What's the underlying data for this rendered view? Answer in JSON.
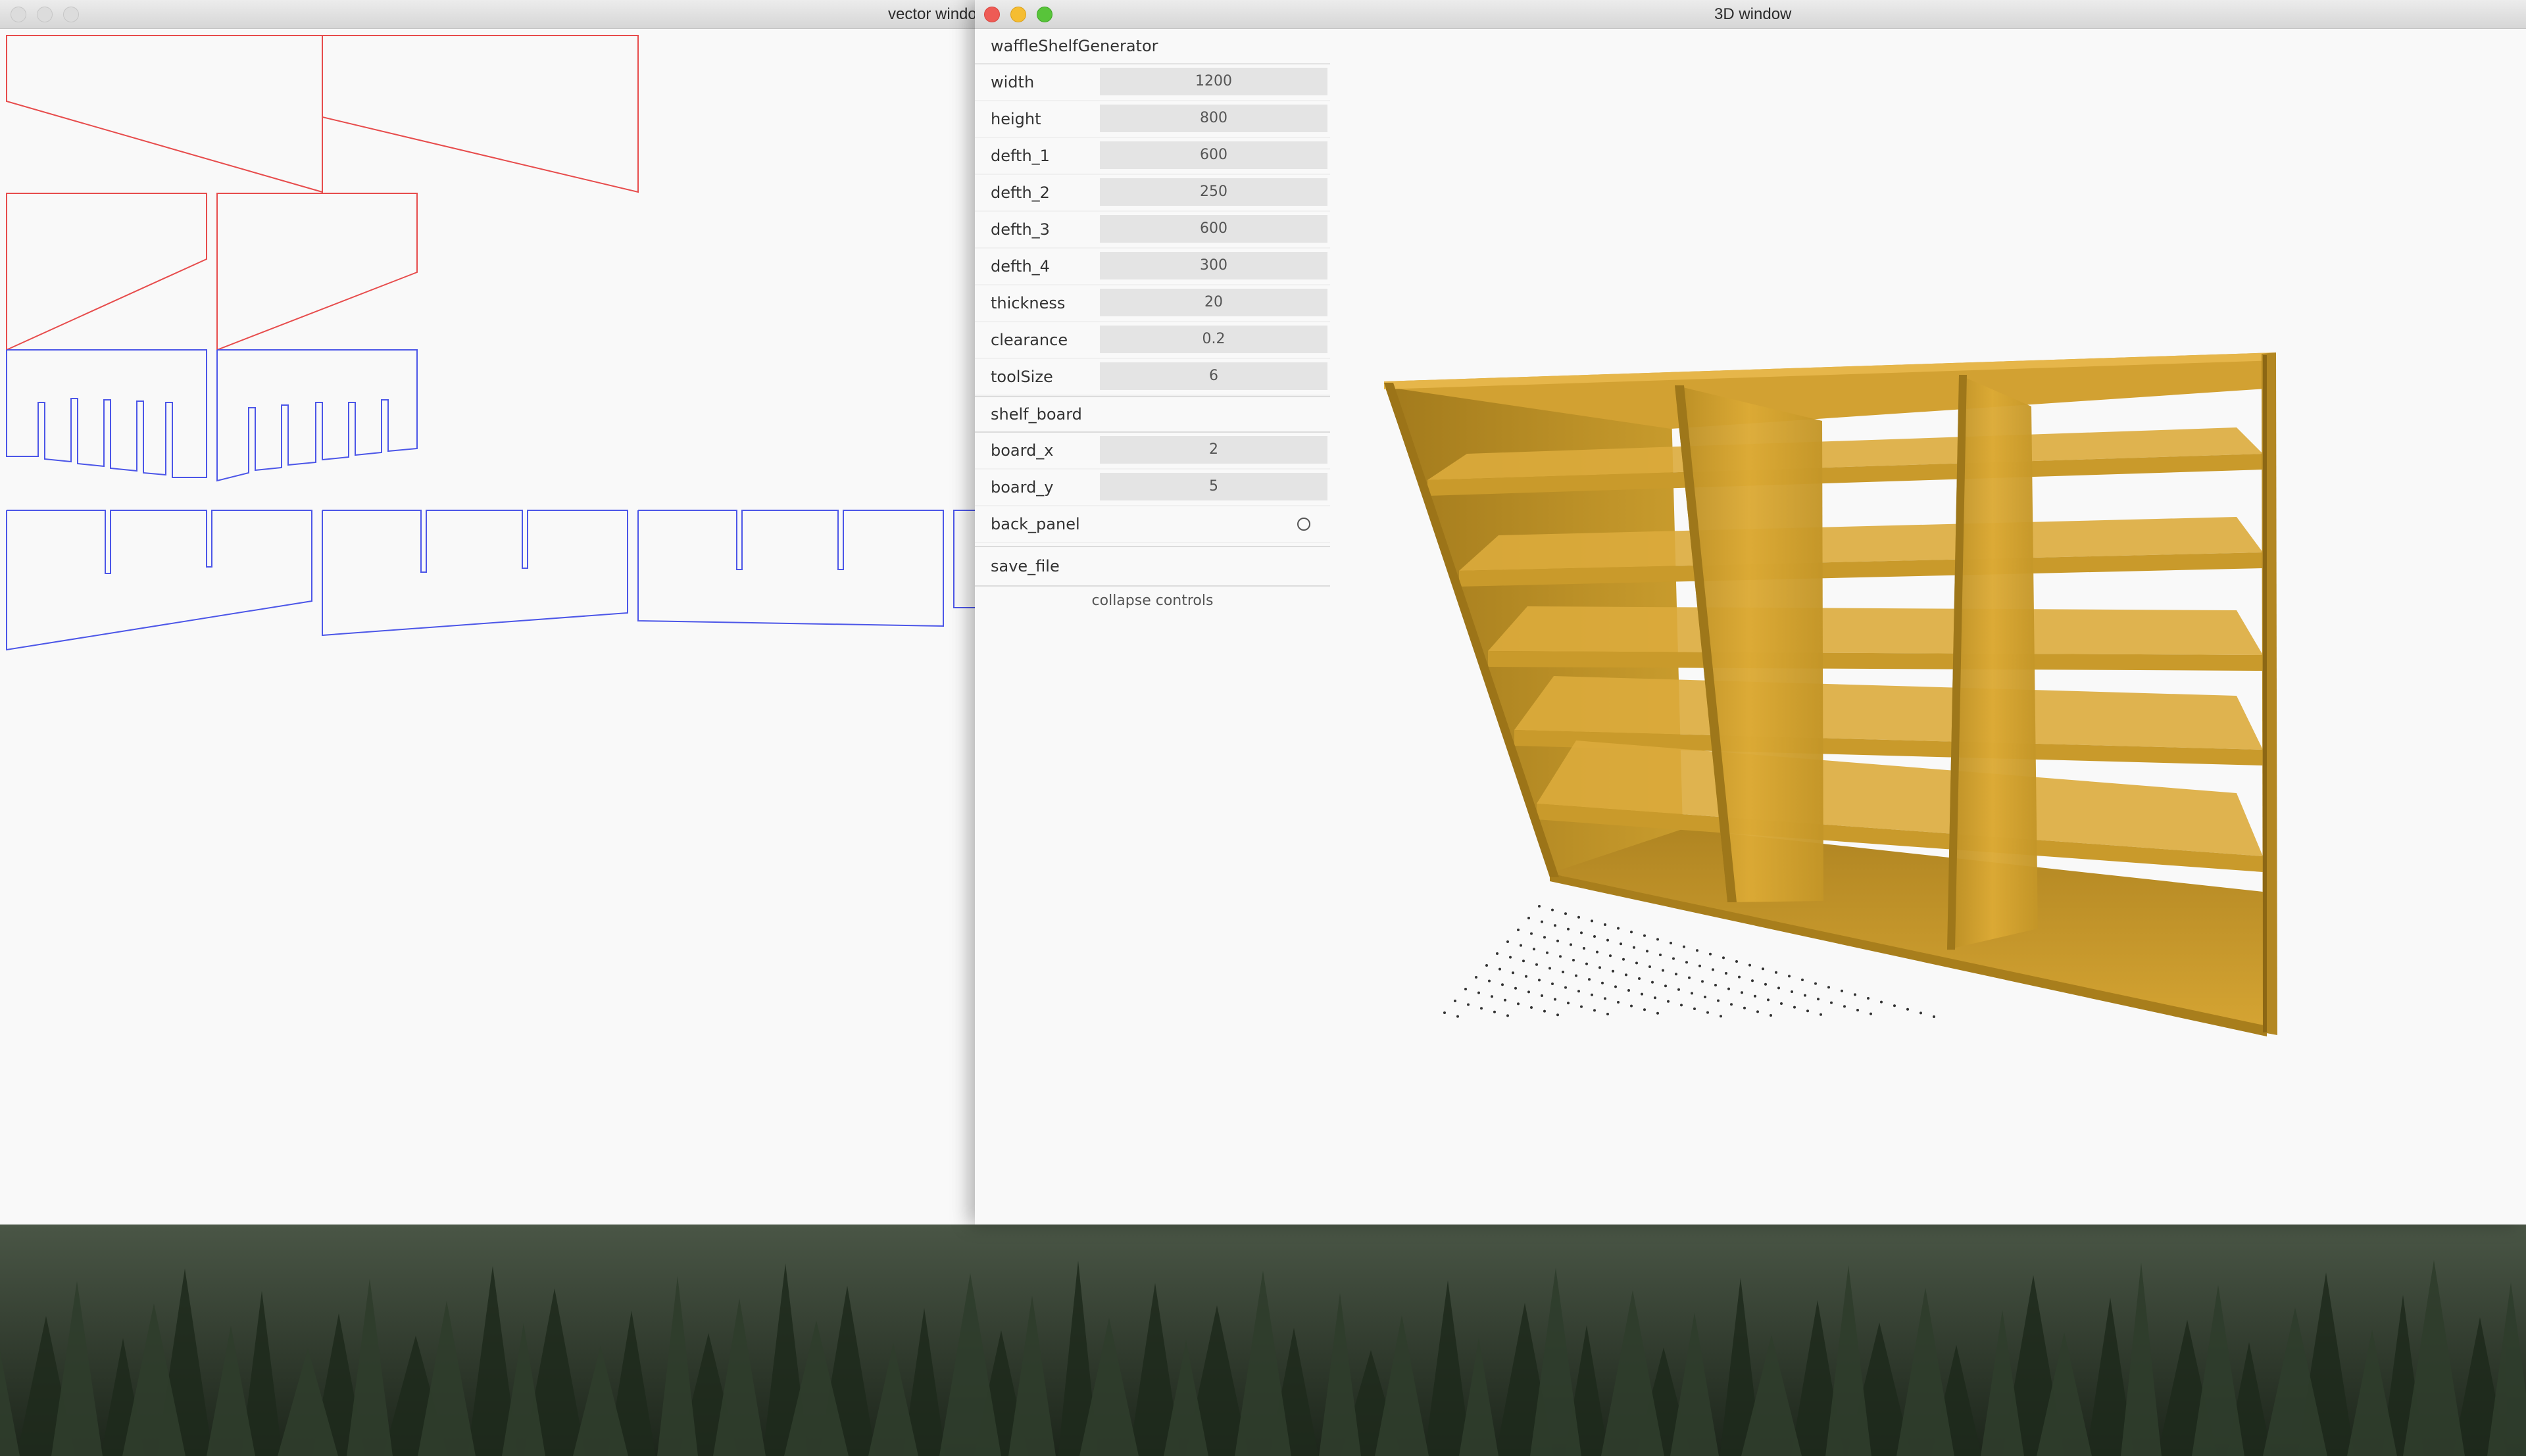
{
  "vector_window": {
    "title": "vector window"
  },
  "window_3d": {
    "title": "3D window"
  },
  "controls": {
    "header": "waffleShelfGenerator",
    "params": [
      {
        "label": "width",
        "value": "1200"
      },
      {
        "label": "height",
        "value": "800"
      },
      {
        "label": "defth_1",
        "value": "600"
      },
      {
        "label": "defth_2",
        "value": "250"
      },
      {
        "label": "defth_3",
        "value": "600"
      },
      {
        "label": "defth_4",
        "value": "300"
      },
      {
        "label": "thickness",
        "value": "20"
      },
      {
        "label": "clearance",
        "value": "0.2"
      },
      {
        "label": "toolSize",
        "value": "6"
      }
    ],
    "folder": "shelf_board",
    "board_params": [
      {
        "label": "board_x",
        "value": "2"
      },
      {
        "label": "board_y",
        "value": "5"
      }
    ],
    "back_panel_label": "back_panel",
    "save_label": "save_file",
    "collapse_label": "collapse controls"
  },
  "colors": {
    "traffic_close": "#ee5b55",
    "traffic_minimize": "#f5bd32",
    "traffic_zoom": "#58c43a",
    "side_panel_outline": "#e74c4c",
    "shelf_outline": "#4c56e8",
    "shelf_wood": "#c89a2a"
  }
}
